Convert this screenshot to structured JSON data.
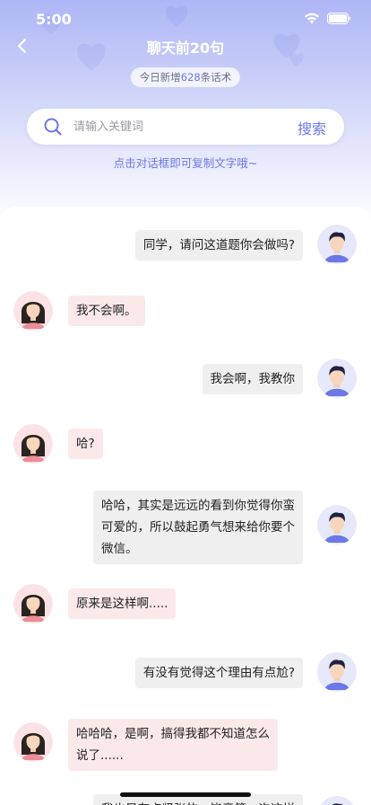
{
  "status": {
    "time": "5:00"
  },
  "nav": {
    "title": "聊天前20句"
  },
  "today": {
    "prefix": "今日新增",
    "count": "628",
    "suffix": "条话术"
  },
  "search": {
    "placeholder": "请输入关键词",
    "button": "搜索"
  },
  "hint": "点击对话框即可复制文字哦~",
  "colors": {
    "accent": "#6b78e6",
    "header_top": "#aeb6f6",
    "bubble_right": "#efefef",
    "bubble_left": "#fbe9ea"
  },
  "messages": [
    {
      "side": "right",
      "text": "同学，请问这道题你会做吗?"
    },
    {
      "side": "left",
      "text": "我不会啊。"
    },
    {
      "side": "right",
      "text": "我会啊，我教你"
    },
    {
      "side": "left",
      "text": "哈?"
    },
    {
      "side": "right",
      "text": "哈哈，其实是远远的看到你觉得你蛮可爱的，所以鼓起勇气想来给你要个微信。"
    },
    {
      "side": "left",
      "text": "原来是这样啊....."
    },
    {
      "side": "right",
      "text": "有没有觉得这个理由有点尬?"
    },
    {
      "side": "left",
      "text": "哈哈哈，是啊，搞得我都不知道怎么说了......"
    },
    {
      "side": "right",
      "text": "我也是有点紧张的，毕竟第一次这样"
    }
  ]
}
